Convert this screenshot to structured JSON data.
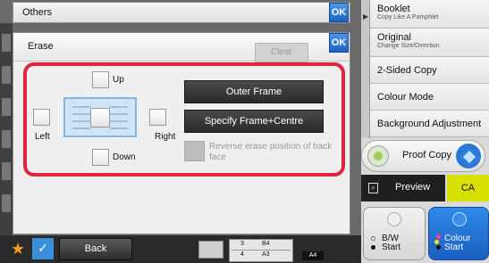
{
  "header": {
    "title": "Others",
    "ok_label": "OK"
  },
  "erase": {
    "title": "Erase",
    "ok_label": "OK",
    "clear_label": "Clear",
    "up_label": "Up",
    "down_label": "Down",
    "left_label": "Left",
    "right_label": "Right",
    "outer_frame_label": "Outer Frame",
    "specify_frame_label": "Specify Frame+Centre",
    "reverse_label": "Reverse erase position of back face"
  },
  "right_panel": {
    "items": [
      {
        "title": "Booklet",
        "subtitle": "Copy Like A Pamphlet"
      },
      {
        "title": "Original",
        "subtitle": "Change Size/Direction."
      },
      {
        "title": "2-Sided Copy"
      },
      {
        "title": "Colour Mode"
      },
      {
        "title": "Background Adjustment"
      }
    ],
    "proof_copy_label": "Proof Copy",
    "preview_label": "Preview",
    "ca_label": "CA",
    "bw_label_1": "B/W",
    "bw_label_2": "Start",
    "colour_label_1": "Colour",
    "colour_label_2": "Start"
  },
  "bottom": {
    "back_label": "Back",
    "trays": [
      {
        "num": "3",
        "size": "B4"
      },
      {
        "num": "4",
        "size": "A3"
      }
    ],
    "tray_selected": "A4"
  },
  "colors": {
    "accent_blue": "#2a78d8",
    "highlight_red": "#e0243a",
    "ca_yellow": "#d8e000",
    "star_orange": "#f0a020"
  }
}
